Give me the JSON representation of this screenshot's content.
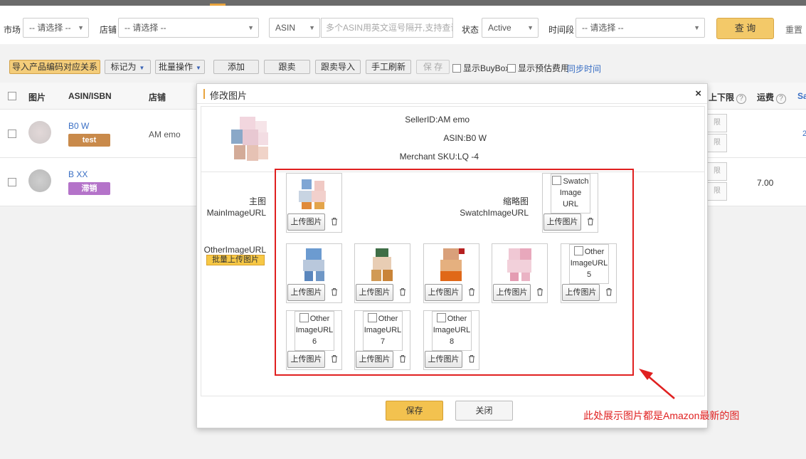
{
  "filters": {
    "market_label": "市场",
    "market_value": "-- 请选择 --",
    "shop_label": "店铺",
    "shop_value": "-- 请选择 --",
    "asin_type": "ASIN",
    "asin_placeholder": "多个ASIN用英文逗号隔开,支持查询",
    "status_label": "状态",
    "status_value": "Active",
    "period_label": "时间段",
    "period_value": "-- 请选择 --",
    "query_label": "查 询",
    "reset_label": "重置"
  },
  "toolbar": {
    "import_map": "导入产品编码对应关系",
    "mark_as": "标记为",
    "batch_ops": "批量操作",
    "add": "添加",
    "follow_sell": "跟卖",
    "follow_import": "跟卖导入",
    "manual_refresh": "手工刷新",
    "save": "保 存",
    "show_buybox": "显示BuyBox",
    "show_est_fee": "显示预估费用",
    "sync_time": "同步时间"
  },
  "table": {
    "headers": {
      "image": "图片",
      "asin": "ASIN/ISBN",
      "shop": "店铺",
      "limit": "上下限",
      "freight": "运费",
      "extra": "Sa"
    },
    "rows": [
      {
        "asin": "B0 W",
        "tag": "test",
        "tag_color": "#c98a4b",
        "shop": "AM emo",
        "freight": "",
        "link": "2"
      },
      {
        "asin": "B XX",
        "tag": "滞销",
        "tag_color": "#b473c9",
        "shop": "",
        "freight": "7.00",
        "link": ""
      }
    ],
    "side_btn": "限"
  },
  "modal": {
    "title": "修改图片",
    "close": "×",
    "seller_id": "SellerID:AM emo",
    "asin": "ASIN:B0 W",
    "sku": "Merchant SKU:LQ -4",
    "main_label_cn": "主图",
    "main_label_en": "MainImageURL",
    "swatch_label_cn": "缩略图",
    "swatch_label_en": "SwatchImageURL",
    "swatch_placeholder": "Swatch Image URL",
    "other_label": "OtherImageURL",
    "bulk_upload": "批量上传图片",
    "upload": "上传图片",
    "other_placeholders": [
      "Other ImageURL 5",
      "Other ImageURL 6",
      "Other ImageURL 7",
      "Other ImageURL 8"
    ],
    "save": "保存",
    "close_btn": "关闭"
  },
  "annotation": "此处展示图片都是Amazon最新的图",
  "colors": {
    "accent": "#e8a33d",
    "highlight": "#e02020",
    "link": "#3a6fc4"
  },
  "icons": [
    "trash-icon",
    "close-icon",
    "chevron-down-icon",
    "help-icon",
    "arrow-icon"
  ]
}
